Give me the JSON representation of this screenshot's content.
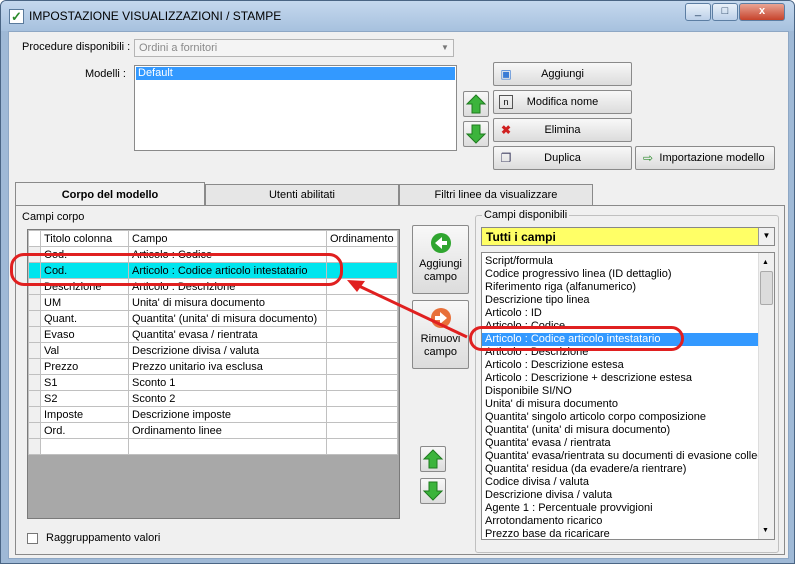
{
  "window": {
    "title": "IMPOSTAZIONE VISUALIZZAZIONI / STAMPE",
    "min": "_",
    "max": "□",
    "close": "x"
  },
  "top": {
    "procedure_label": "Procedure disponibili :",
    "procedure_value": "Ordini a fornitori",
    "modelli_label": "Modelli :",
    "modelli_items": [
      "Default"
    ],
    "buttons": {
      "aggiungi": "Aggiungi",
      "modifica": "Modifica nome",
      "elimina": "Elimina",
      "duplica": "Duplica",
      "importazione": "Importazione modello"
    }
  },
  "tabs": [
    "Corpo del modello",
    "Utenti abilitati",
    "Filtri linee da visualizzare"
  ],
  "campi_corpo": {
    "label": "Campi corpo",
    "columns": [
      "Titolo colonna",
      "Campo",
      "Ordinamento"
    ],
    "rows": [
      [
        "Cod.",
        "Articolo : Codice",
        ""
      ],
      [
        "Cod.",
        "Articolo : Codice articolo intestatario",
        ""
      ],
      [
        "Descrizione",
        "Articolo : Descrizione",
        ""
      ],
      [
        "UM",
        "Unita' di misura documento",
        ""
      ],
      [
        "Quant.",
        "Quantita' (unita' di misura documento)",
        ""
      ],
      [
        "Evaso",
        "Quantita' evasa / rientrata",
        ""
      ],
      [
        "Val",
        "Descrizione divisa / valuta",
        ""
      ],
      [
        "Prezzo",
        "Prezzo unitario iva esclusa",
        ""
      ],
      [
        "S1",
        "Sconto 1",
        ""
      ],
      [
        "S2",
        "Sconto 2",
        ""
      ],
      [
        "Imposte",
        "Descrizione imposte",
        ""
      ],
      [
        "Ord.",
        "Ordinamento linee",
        ""
      ],
      [
        "",
        "",
        ""
      ]
    ],
    "selected_row": 1
  },
  "middle": {
    "aggiungi": [
      "Aggiungi",
      "campo"
    ],
    "rimuovi": [
      "Rimuovi",
      "campo"
    ]
  },
  "campi_disponibili": {
    "label": "Campi disponibili",
    "filter": "Tutti i campi",
    "items": [
      "Script/formula",
      "Codice progressivo linea (ID dettaglio)",
      "Riferimento riga (alfanumerico)",
      "Descrizione tipo linea",
      "Articolo : ID",
      "Articolo : Codice",
      "Articolo : Codice articolo intestatario",
      "Articolo : Descrizione",
      "Articolo : Descrizione estesa",
      "Articolo : Descrizione + descrizione estesa",
      "Disponibile SI/NO",
      "Unita' di misura documento",
      "Quantita' singolo articolo corpo composizione",
      "Quantita' (unita' di misura documento)",
      "Quantita' evasa / rientrata",
      "Quantita' evasa/rientrata su documenti di evasione colleg",
      "Quantita' residua (da evadere/a rientrare)",
      "Codice divisa / valuta",
      "Descrizione divisa / valuta",
      "Agente 1 : Percentuale provvigioni",
      "Arrotondamento ricarico",
      "Prezzo base da ricaricare"
    ],
    "selected": 6
  },
  "raggruppamento": "Raggruppamento valori",
  "colors": {
    "selection": "#00e5ee",
    "list_selection": "#3399ff",
    "highlight": "#e02020",
    "filter_bg": "#ffff66"
  }
}
